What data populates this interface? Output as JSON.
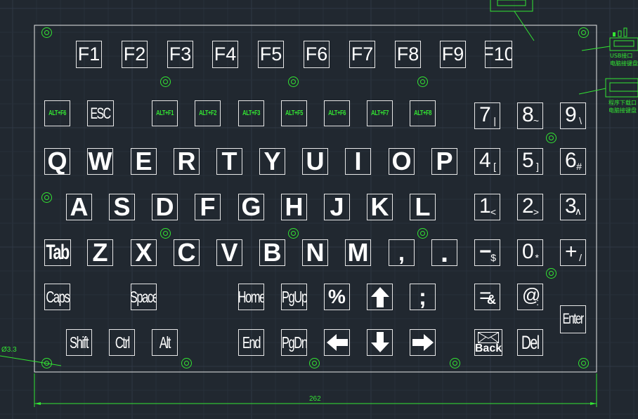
{
  "fkeys": [
    "F1",
    "F2",
    "F3",
    "F4",
    "F5",
    "F6",
    "F7",
    "F8",
    "F9",
    "F10"
  ],
  "altkeys": [
    "ALT+F6",
    "ALT+F1",
    "ALT+F2",
    "ALT+F3",
    "ALT+F5",
    "ALT+F6",
    "ALT+F7",
    "ALT+F8"
  ],
  "esc": "ESC",
  "row_qwerty": [
    "Q",
    "W",
    "E",
    "R",
    "T",
    "Y",
    "U",
    "I",
    "O",
    "P"
  ],
  "row_asdf": [
    "A",
    "S",
    "D",
    "F",
    "G",
    "H",
    "J",
    "K",
    "L"
  ],
  "row_zxcv": {
    "tab": "Tab",
    "letters": [
      "Z",
      "X",
      "C",
      "V",
      "B",
      "N",
      "M"
    ],
    "comma": ",",
    "period": "."
  },
  "row_caps": {
    "caps": "Caps",
    "space": "Space",
    "home": "Home",
    "pgup": "PgUp",
    "percent": "%",
    "up": "↑",
    "semicolon": ";"
  },
  "row_shift": {
    "shift": "Shift",
    "ctrl": "Ctrl",
    "alt": "Alt",
    "end": "End",
    "pgdn": "PgDn",
    "left": "←",
    "down": "↓",
    "right": "→",
    "back": "Back",
    "del": "Del"
  },
  "numpad": [
    {
      "big": "7",
      "sm": "|"
    },
    {
      "big": "8",
      "sm": "~"
    },
    {
      "big": "9",
      "sm": "\\"
    },
    {
      "big": "4",
      "sm": "["
    },
    {
      "big": "5",
      "sm": "]"
    },
    {
      "big": "6",
      "sm": "#"
    },
    {
      "big": "1",
      "sm": "<"
    },
    {
      "big": "2",
      "sm": ">"
    },
    {
      "big": "3",
      "sm": "∧"
    },
    {
      "big": "−",
      "sm": "$"
    },
    {
      "big": "0",
      "sm": "*"
    },
    {
      "big": "+",
      "sm": "/"
    },
    {
      "big": "=",
      "sm": "&"
    },
    {
      "big": "@",
      "sm": ":"
    }
  ],
  "enter": "Enter",
  "dimension_width": "262",
  "hole_diameter": "Ø3.3",
  "usb_label": "USB接口",
  "usb_sub": "电脑接键盘",
  "prog_label": "程序下载口",
  "prog_sub": "电脑接键盘",
  "colors": {
    "background": "#212830",
    "lines": "#e8e8e8",
    "annotation": "#33e633"
  }
}
